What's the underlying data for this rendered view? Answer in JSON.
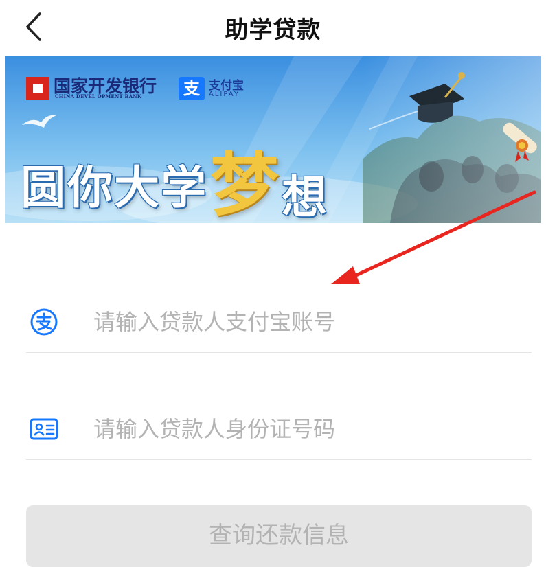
{
  "header": {
    "title": "助学贷款",
    "back_icon": "chevron-left-icon"
  },
  "banner": {
    "bank_name": "国家开发银行",
    "bank_name_en": "CHINA DEVEL OPMENT BANK",
    "alipay_badge": "支",
    "alipay_name": "支付宝",
    "alipay_name_en": "ALIPAY",
    "slogan_part1": "圆你大学",
    "slogan_highlight": "梦",
    "slogan_part2": "想",
    "colors": {
      "sky_top": "#3b8fe0",
      "sky_bottom": "#9fd3f5",
      "highlight": "#f3c63f",
      "bank_red": "#d9261c"
    }
  },
  "form": {
    "alipay_account": {
      "icon": "alipay-icon",
      "placeholder": "请输入贷款人支付宝账号",
      "value": ""
    },
    "id_number": {
      "icon": "id-card-icon",
      "placeholder": "请输入贷款人身份证号码",
      "value": ""
    },
    "submit_label": "查询还款信息"
  },
  "colors": {
    "accent": "#1677ff",
    "annotation_arrow": "#e8261f",
    "placeholder": "#b3b3b3",
    "button_disabled_bg": "#e5e5e5"
  }
}
